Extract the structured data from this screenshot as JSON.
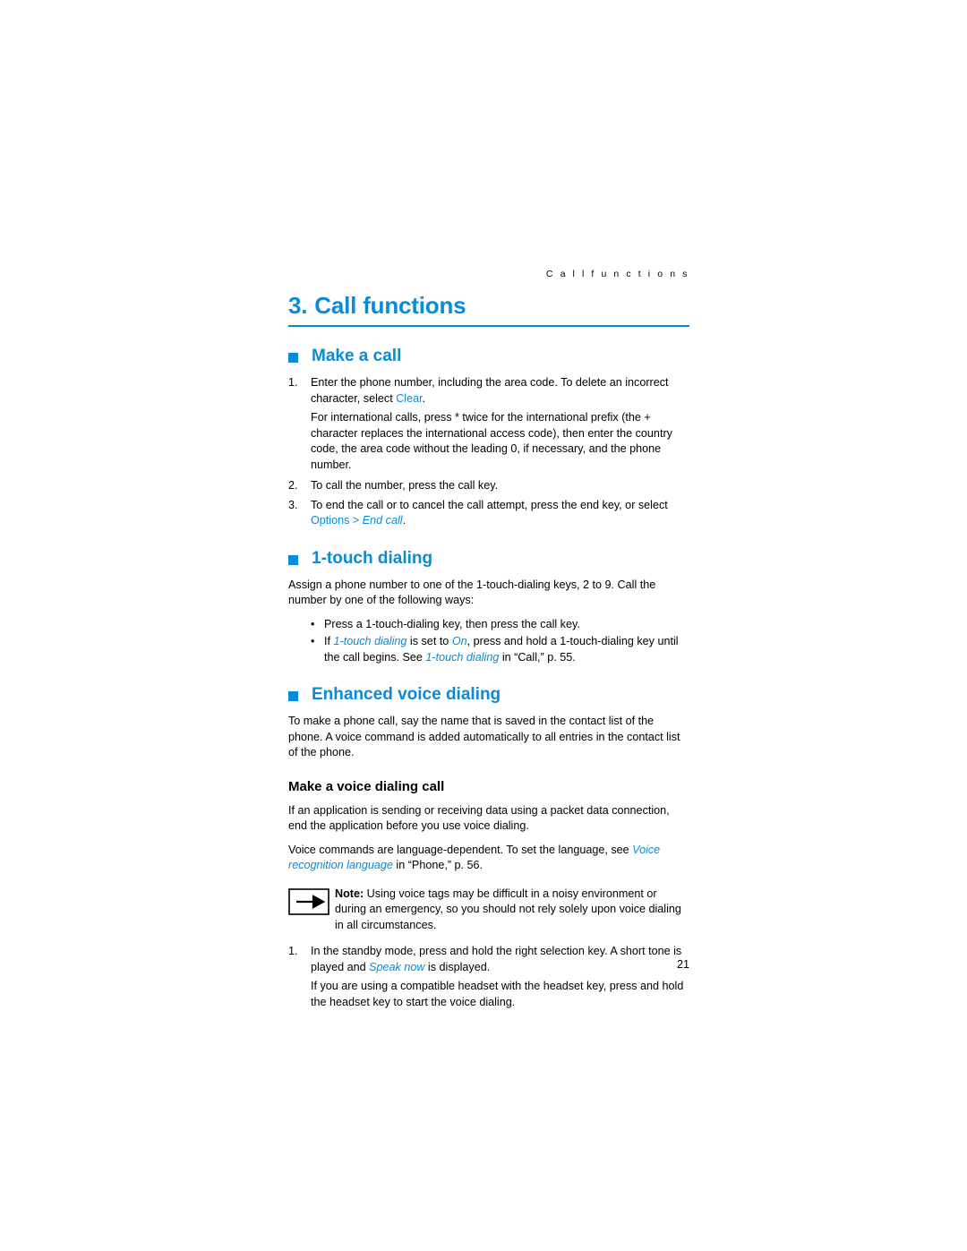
{
  "page": {
    "running_head": "C a l l   f u n c t i o n s",
    "page_number": "21",
    "accent_color": "#0a8ad8"
  },
  "chapter": {
    "number": "3.",
    "title": "Call functions"
  },
  "sections": {
    "make_a_call": {
      "heading": "Make a call",
      "item1_marker": "1.",
      "item1_a": "Enter the phone number, including the area code. To delete an incorrect character, select ",
      "item1_link": "Clear",
      "item1_b": ".",
      "para_intl": "For international calls, press * twice for the international prefix (the + character replaces the international access code), then enter the country code, the area code without the leading 0, if necessary, and the phone number.",
      "item2_marker": "2.",
      "item2": "To call the number, press the call key.",
      "item3_marker": "3.",
      "item3_a": "To end the call or to cancel the call attempt, press the end key, or select ",
      "item3_options": "Options",
      "item3_sep": " > ",
      "item3_endcall": "End call",
      "item3_b": "."
    },
    "one_touch_dialing": {
      "heading": "1-touch dialing",
      "intro": "Assign a phone number to one of the 1-touch-dialing keys, 2 to 9. Call the number by one of the following ways:",
      "bullet1": "Press a 1-touch-dialing key, then press the call key.",
      "bullet2_a": "If ",
      "bullet2_link1": "1-touch dialing",
      "bullet2_b": " is set to ",
      "bullet2_link2": "On",
      "bullet2_c": ", press and hold a 1-touch-dialing key until the call begins. See ",
      "bullet2_link3": "1-touch dialing",
      "bullet2_d": " in “Call,” p. 55."
    },
    "enhanced_voice_dialing": {
      "heading": "Enhanced voice dialing",
      "intro": "To make a phone call, say the name that is saved in the contact list of the phone. A voice command is added automatically to all entries in the contact list of the phone.",
      "subheading": "Make a voice dialing call",
      "para1": "If an application is sending or receiving data using a packet data connection, end the application before you use voice dialing.",
      "para2_a": "Voice commands are language-dependent. To set the language, see ",
      "para2_link": "Voice recognition language",
      "para2_b": " in “Phone,” p. 56.",
      "note_label": "Note:",
      "note_text": " Using voice tags may be difficult in a noisy environment or during an emergency, so you should not rely solely upon voice dialing in all circumstances.",
      "step1_marker": "1.",
      "step1_a": "In the standby mode, press and hold the right selection key. A short tone is played and ",
      "step1_link": "Speak now",
      "step1_b": " is displayed.",
      "step1_para": "If you are using a compatible headset with the headset key, press and hold the headset key to start the voice dialing."
    }
  },
  "icons": {
    "note": "note-arrow-icon",
    "section_bullet": "square-bullet-icon",
    "list_bullet": "dot-bullet-icon"
  }
}
